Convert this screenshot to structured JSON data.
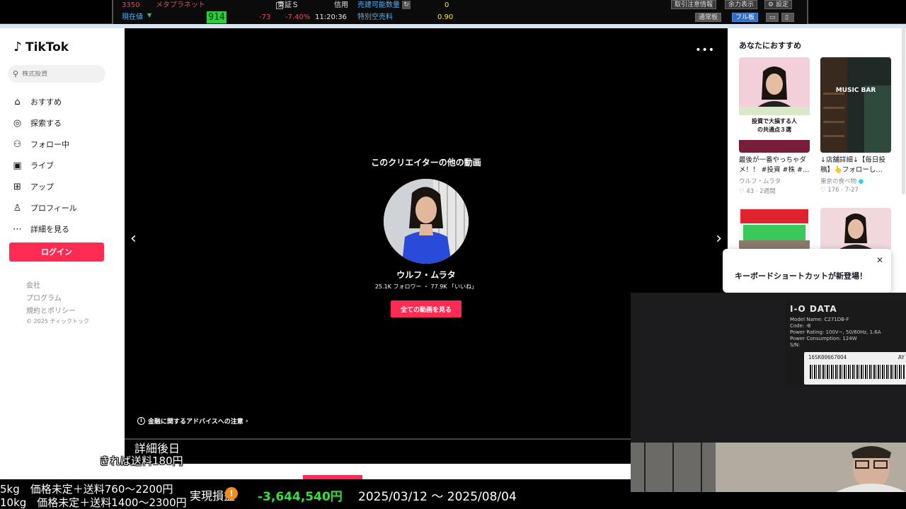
{
  "ticker": {
    "code": "3350",
    "name": "メタプラネット",
    "current_label": "現在値",
    "price": "914",
    "market": "東証Ｓ",
    "margin": "信用",
    "sellable_label": "売建可能数量",
    "sellable_value": "0",
    "change": "-73",
    "change_pct": "-7.40%",
    "time": "11:20:36",
    "special_label": "特別空売料",
    "special_value": "0.90",
    "buttons": {
      "caution": "取引注意情報",
      "power": "余力表示",
      "settings": "設定",
      "normal_board": "通常板",
      "full_board": "フル板"
    }
  },
  "tiktok": {
    "logo": "TikTok",
    "search_placeholder": "株式投資",
    "nav": [
      {
        "label": "おすすめ",
        "icon": "home-icon"
      },
      {
        "label": "探索する",
        "icon": "compass-icon"
      },
      {
        "label": "フォロー中",
        "icon": "user-follow-icon"
      },
      {
        "label": "ライブ",
        "icon": "live-tv-icon"
      },
      {
        "label": "アップ",
        "icon": "upload-plus-icon"
      },
      {
        "label": "プロフィール",
        "icon": "profile-icon"
      },
      {
        "label": "詳細を見る",
        "icon": "more-dots-icon"
      }
    ],
    "login": "ログイン",
    "footer_links": [
      "会社",
      "プログラム",
      "規約とポリシー"
    ],
    "copyright": "© 2025 ティックトック"
  },
  "video": {
    "more": "…",
    "section_title": "このクリエイターの他の動画",
    "creator_name": "ウルフ・ムラタ",
    "stats": "25.1K フォロワー ・ 77.9K 「いいね」",
    "all_videos_button": "全ての動画を見る",
    "advice_link": "金融に関するアドバイスへの注意"
  },
  "recommendations": {
    "title": "あなたにおすすめ",
    "items": [
      {
        "thumb_text_1": "投資で大損する人",
        "thumb_text_2": "の共通点３選",
        "caption": "最後が一番やっちゃダメ！！ #投資 #株 #…",
        "author": "ウルフ・ムラタ",
        "likes": "43",
        "age": "2週間"
      },
      {
        "thumb_text_1": "MUSIC BAR",
        "caption": "↓店舗詳細↓【毎日投稿】👆フォローし…",
        "author": "東京の食べ物",
        "likes": "176",
        "age": "7-27"
      }
    ],
    "toast": "キーボードショートカットが新登場！"
  },
  "webcam": {
    "brand": "I-O DATA",
    "model_line1": "Model Name: C271DB-F",
    "model_line2": "Code: -B",
    "model_line3": "Power Rating: 100V~, 50/60Hz, 1.6A",
    "model_line4": "Power Consumption: 124W",
    "model_line5": "S/N:",
    "serial": "16SK006670O4",
    "serial_suffix": "AY"
  },
  "overlay": {
    "detail": "詳細後日",
    "shipping": "きれば送料180円",
    "line_5kg": "5kg　価格未定＋送料760〜2200円",
    "line_10kg": "10kg　価格未定＋送料1400〜2300円",
    "pl_label": "実現損益",
    "pl_value": "-3,644,540円",
    "pl_range": "2025/03/12 〜 2025/08/04"
  },
  "colors": {
    "tiktok_pink": "#fe2c55",
    "profit_green": "#33e23a",
    "ticker_red": "#e84860",
    "ticker_blue": "#4fb3ff"
  }
}
